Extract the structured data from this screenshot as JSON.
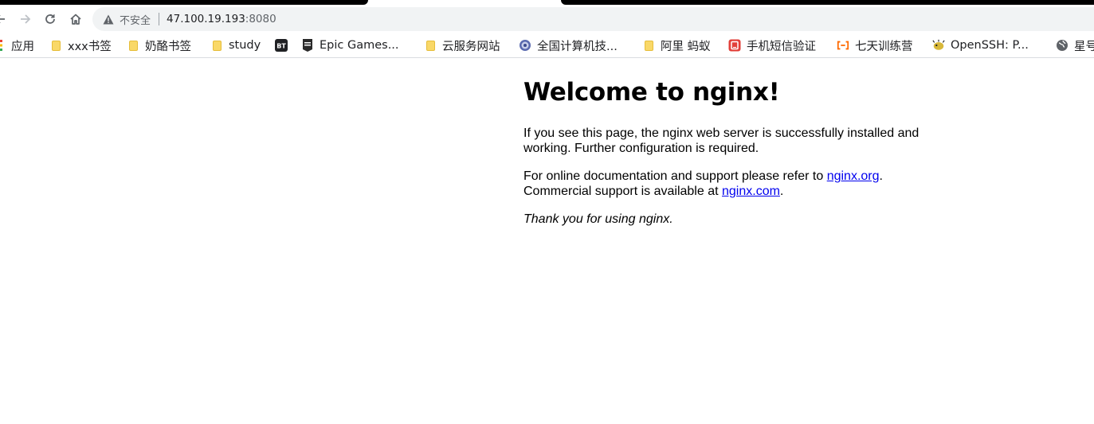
{
  "browser": {
    "security_label": "不安全",
    "url_host": "47.100.19.193",
    "url_port": ":8080"
  },
  "bookmarks": [
    {
      "label": "应用",
      "icon": "apps-grid-icon"
    },
    {
      "label": "xxx书签",
      "icon": "folder-icon"
    },
    {
      "label": "奶酪书签",
      "icon": "folder-icon"
    },
    {
      "label": "study",
      "icon": "folder-icon"
    },
    {
      "label": "",
      "icon": "bt-icon",
      "icon_text": "BT"
    },
    {
      "label": "Epic Games...",
      "icon": "epic-games-icon"
    },
    {
      "label": "云服务网站",
      "icon": "folder-icon"
    },
    {
      "label": "全国计算机技...",
      "icon": "globe-icon"
    },
    {
      "label": "阿里 蚂蚁",
      "icon": "folder-icon"
    },
    {
      "label": "手机短信验证",
      "icon": "sms-icon"
    },
    {
      "label": "七天训练营",
      "icon": "aliyun-icon"
    },
    {
      "label": "OpenSSH: P...",
      "icon": "openssh-icon"
    },
    {
      "label": "星号",
      "icon": "world-icon"
    }
  ],
  "content": {
    "heading": "Welcome to nginx!",
    "para1": "If you see this page, the nginx web server is successfully installed and working. Further configuration is required.",
    "para2_prefix": "For online documentation and support please refer to ",
    "link1": "nginx.org",
    "para2_mid": ".",
    "para2_line2": "Commercial support is available at ",
    "link2": "nginx.com",
    "para2_end": ".",
    "thanks": "Thank you for using nginx."
  },
  "colors": {
    "link": "#0000ee",
    "folder": "#f9d868",
    "omnibox_bg": "#f1f3f4"
  }
}
